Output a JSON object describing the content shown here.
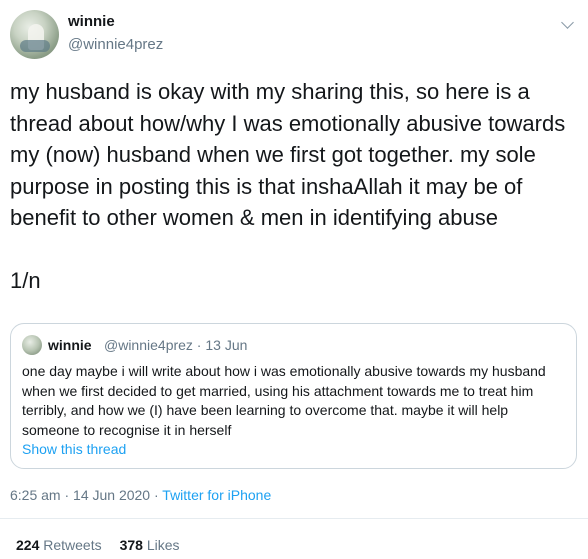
{
  "author": {
    "display_name": "winnie",
    "handle": "@winnie4prez",
    "avatar_icon": "profile-photo"
  },
  "tweet": {
    "text": "my husband is okay with my sharing this, so here is a thread about how/why I was emotionally abusive towards my (now) husband when we first got together. my sole purpose in posting this is that inshaAllah it may be of benefit to other women & men in identifying abuse\n\n1/n"
  },
  "quoted": {
    "display_name": "winnie",
    "meta": "@winnie4prez · 13 Jun",
    "text": "one day maybe i will write about how i was emotionally abusive towards my husband when we first decided to get married, using his attachment towards me to treat him terribly, and how we (I) have been learning to overcome that. maybe it will help someone to recognise it in herself",
    "show_thread_label": "Show this thread"
  },
  "timestamp": "6:25 am · 14 Jun 2020 · ",
  "source": "Twitter for iPhone",
  "stats": {
    "retweets_count": "224",
    "retweets_label": "Retweets",
    "likes_count": "378",
    "likes_label": "Likes"
  },
  "colors": {
    "link": "#1da1f2",
    "muted": "#657786",
    "text": "#14171a",
    "border": "#ccd6dd"
  }
}
